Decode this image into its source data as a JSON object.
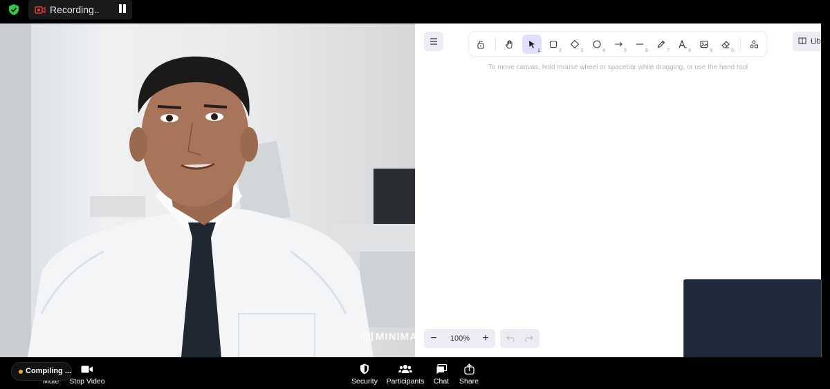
{
  "topbar": {
    "recording_label": "Recording..",
    "shield_color": "#2ecc40",
    "record_icon_color": "#e53935"
  },
  "video": {
    "watermark": "MINIMAX"
  },
  "whiteboard": {
    "tools": [
      {
        "name": "lock-icon",
        "key": ""
      },
      {
        "name": "hand-icon",
        "key": ""
      },
      {
        "name": "select-arrow-icon",
        "key": "1"
      },
      {
        "name": "rectangle-icon",
        "key": "2"
      },
      {
        "name": "diamond-icon",
        "key": "3"
      },
      {
        "name": "ellipse-icon",
        "key": "4"
      },
      {
        "name": "arrow-icon",
        "key": "5"
      },
      {
        "name": "line-icon",
        "key": "6"
      },
      {
        "name": "pencil-icon",
        "key": "7"
      },
      {
        "name": "text-icon",
        "key": "8"
      },
      {
        "name": "image-icon",
        "key": "9"
      },
      {
        "name": "eraser-icon",
        "key": "0"
      },
      {
        "name": "shapes-icon",
        "key": ""
      }
    ],
    "library_label": "Libr",
    "hint": "To move canvas, hold mouse wheel or spacebar while dragging, or use the hand tool",
    "zoom": "100%",
    "accent": "#e0dfff"
  },
  "bottombar": {
    "compiling_label": "Compiling ...",
    "mute_label": "Mute",
    "stop_video_label": "Stop Video",
    "security_label": "Security",
    "participants_label": "Participants",
    "chat_label": "Chat",
    "share_label": "Share"
  }
}
